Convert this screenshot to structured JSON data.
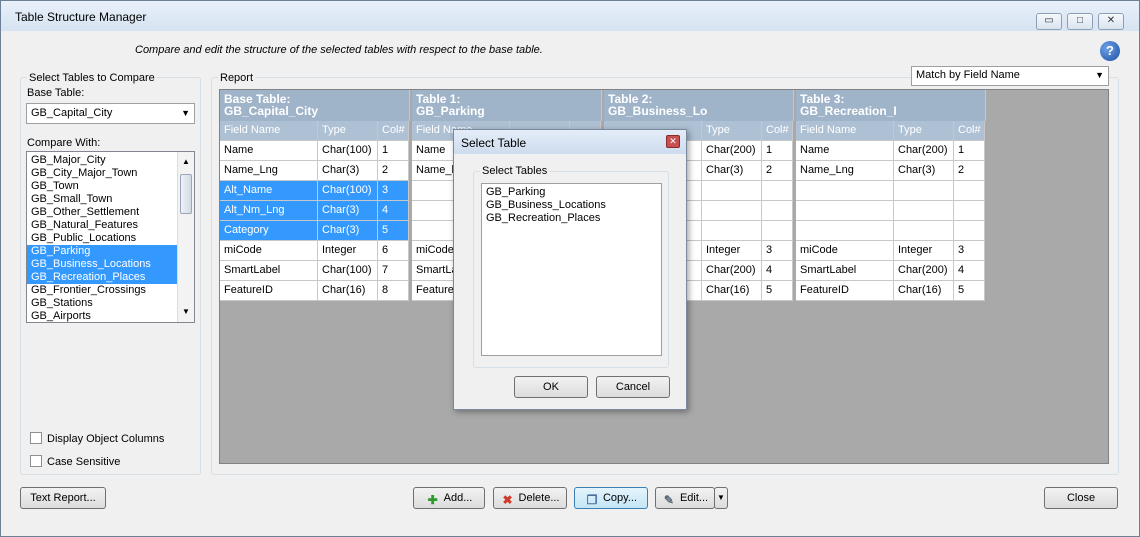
{
  "window": {
    "title": "Table Structure Manager"
  },
  "subtitle": "Compare and edit the structure of the selected tables with respect to the base table.",
  "help_icon_glyph": "?",
  "left_panel": {
    "group_label": "Select Tables to Compare",
    "base_table_label": "Base Table:",
    "base_table_value": "GB_Capital_City",
    "compare_with_label": "Compare With:",
    "compare_items": [
      {
        "label": "GB_Major_City",
        "selected": false
      },
      {
        "label": "GB_City_Major_Town",
        "selected": false
      },
      {
        "label": "GB_Town",
        "selected": false
      },
      {
        "label": "GB_Small_Town",
        "selected": false
      },
      {
        "label": "GB_Other_Settlement",
        "selected": false
      },
      {
        "label": "GB_Natural_Features",
        "selected": false
      },
      {
        "label": "GB_Public_Locations",
        "selected": false
      },
      {
        "label": "GB_Parking",
        "selected": true
      },
      {
        "label": "GB_Business_Locations",
        "selected": true
      },
      {
        "label": "GB_Recreation_Places",
        "selected": true
      },
      {
        "label": "GB_Frontier_Crossings",
        "selected": false
      },
      {
        "label": "GB_Stations",
        "selected": false
      },
      {
        "label": "GB_Airports",
        "selected": false
      }
    ],
    "display_object_columns": "Display Object Columns",
    "case_sensitive": "Case Sensitive"
  },
  "report": {
    "label": "Report",
    "match_by": "Match by Field Name",
    "tables": [
      {
        "header1": "Base Table:",
        "header2": "GB_Capital_City",
        "subheaders": [
          "Field Name",
          "Type",
          "Col#"
        ],
        "rows": [
          [
            "Name",
            "Char(100)",
            "1"
          ],
          [
            "Name_Lng",
            "Char(3)",
            "2"
          ],
          [
            "Alt_Name",
            "Char(100)",
            "3"
          ],
          [
            "Alt_Nm_Lng",
            "Char(3)",
            "4"
          ],
          [
            "Category",
            "Char(3)",
            "5"
          ],
          [
            "miCode",
            "Integer",
            "6"
          ],
          [
            "SmartLabel",
            "Char(100)",
            "7"
          ],
          [
            "FeatureID",
            "Char(16)",
            "8"
          ]
        ]
      },
      {
        "header1": "Table 1:",
        "header2": "GB_Parking",
        "subheaders": [
          "Field Name",
          "",
          ""
        ],
        "rows": [
          [
            "Name",
            "",
            ""
          ],
          [
            "Name_l",
            "",
            ""
          ],
          [
            "",
            "",
            ""
          ],
          [
            "",
            "",
            ""
          ],
          [
            "",
            "",
            ""
          ],
          [
            "miCode",
            "",
            ""
          ],
          [
            "SmartLa",
            "",
            ""
          ],
          [
            "Feature",
            "",
            ""
          ]
        ]
      },
      {
        "header1": "Table 2:",
        "header2": "GB_Business_Lo",
        "subheaders": [
          "",
          "Type",
          "Col#"
        ],
        "rows": [
          [
            "",
            "Char(200)",
            "1"
          ],
          [
            "",
            "Char(3)",
            "2"
          ],
          [
            "",
            "",
            ""
          ],
          [
            "",
            "",
            ""
          ],
          [
            "",
            "",
            ""
          ],
          [
            "",
            "Integer",
            "3"
          ],
          [
            "",
            "Char(200)",
            "4"
          ],
          [
            "",
            "Char(16)",
            "5"
          ]
        ]
      },
      {
        "header1": "Table 3:",
        "header2": "GB_Recreation_I",
        "subheaders": [
          "Field Name",
          "Type",
          "Col#"
        ],
        "rows": [
          [
            "Name",
            "Char(200)",
            "1"
          ],
          [
            "Name_Lng",
            "Char(3)",
            "2"
          ],
          [
            "",
            "",
            ""
          ],
          [
            "",
            "",
            ""
          ],
          [
            "",
            "",
            ""
          ],
          [
            "miCode",
            "Integer",
            "3"
          ],
          [
            "SmartLabel",
            "Char(200)",
            "4"
          ],
          [
            "FeatureID",
            "Char(16)",
            "5"
          ]
        ]
      }
    ]
  },
  "dialog": {
    "title": "Select Table",
    "group_label": "Select Tables",
    "items": [
      "GB_Parking",
      "GB_Business_Locations",
      "GB_Recreation_Places"
    ],
    "ok": "OK",
    "cancel": "Cancel"
  },
  "buttons": {
    "text_report": "Text Report...",
    "add": "Add...",
    "delete": "Delete...",
    "copy": "Copy...",
    "edit": "Edit...",
    "close": "Close"
  },
  "colors": {
    "header": "#9fb3c9",
    "subheader": "#aec0d4",
    "selection": "#3399ff",
    "grid_bg": "#a9a9a9"
  },
  "icons": {
    "add": "plus-icon",
    "delete": "x-icon",
    "copy": "copy-icon",
    "edit": "pencil-icon"
  }
}
